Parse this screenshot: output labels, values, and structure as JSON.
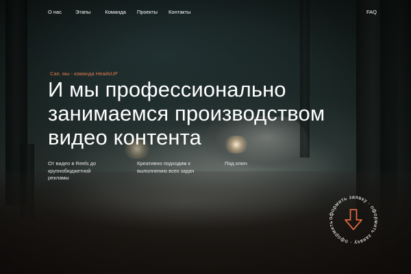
{
  "nav": {
    "items": [
      {
        "label": "О нас"
      },
      {
        "label": "Этапы"
      },
      {
        "label": "Команда"
      },
      {
        "label": "Проекты"
      },
      {
        "label": "Контакты"
      }
    ],
    "faq": "FAQ"
  },
  "hero": {
    "eyebrow": "Сап, мы - команда HeadsUP",
    "headline_lines": [
      "И мы профессионально",
      "занимаемся производством",
      "видео контента"
    ],
    "features": [
      "От видео в Reels до крупнобюджетной рекламы",
      "Креативно подходим к выполнению всех задач",
      "Под ключ"
    ]
  },
  "cta_badge": {
    "circle_text": "оформить заявку · оформить заявку · оформить заявку ·",
    "icon": "arrow-down-icon",
    "accent_color": "#e0683f"
  },
  "colors": {
    "accent": "#e07a4f",
    "text": "#ffffff"
  }
}
